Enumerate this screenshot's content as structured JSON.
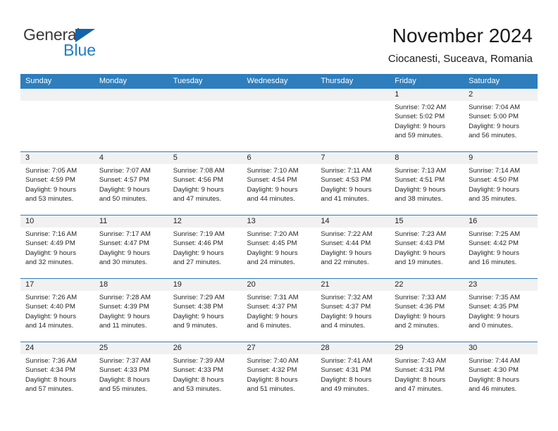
{
  "brand": {
    "name_part1": "General",
    "name_part2": "Blue",
    "triangle_color": "#1264ac",
    "blue_color": "#1f7dc4"
  },
  "header": {
    "title": "November 2024",
    "subtitle": "Ciocanesti, Suceava, Romania"
  },
  "theme": {
    "header_blue": "#2e7ebd",
    "date_band_gray": "#f1f1f1",
    "text_color": "#262626"
  },
  "weekdays": [
    "Sunday",
    "Monday",
    "Tuesday",
    "Wednesday",
    "Thursday",
    "Friday",
    "Saturday"
  ],
  "weeks": [
    [
      {
        "date": "",
        "sunrise": "",
        "sunset": "",
        "daylight_line1": "",
        "daylight_line2": ""
      },
      {
        "date": "",
        "sunrise": "",
        "sunset": "",
        "daylight_line1": "",
        "daylight_line2": ""
      },
      {
        "date": "",
        "sunrise": "",
        "sunset": "",
        "daylight_line1": "",
        "daylight_line2": ""
      },
      {
        "date": "",
        "sunrise": "",
        "sunset": "",
        "daylight_line1": "",
        "daylight_line2": ""
      },
      {
        "date": "",
        "sunrise": "",
        "sunset": "",
        "daylight_line1": "",
        "daylight_line2": ""
      },
      {
        "date": "1",
        "sunrise": "Sunrise: 7:02 AM",
        "sunset": "Sunset: 5:02 PM",
        "daylight_line1": "Daylight: 9 hours",
        "daylight_line2": "and 59 minutes."
      },
      {
        "date": "2",
        "sunrise": "Sunrise: 7:04 AM",
        "sunset": "Sunset: 5:00 PM",
        "daylight_line1": "Daylight: 9 hours",
        "daylight_line2": "and 56 minutes."
      }
    ],
    [
      {
        "date": "3",
        "sunrise": "Sunrise: 7:05 AM",
        "sunset": "Sunset: 4:59 PM",
        "daylight_line1": "Daylight: 9 hours",
        "daylight_line2": "and 53 minutes."
      },
      {
        "date": "4",
        "sunrise": "Sunrise: 7:07 AM",
        "sunset": "Sunset: 4:57 PM",
        "daylight_line1": "Daylight: 9 hours",
        "daylight_line2": "and 50 minutes."
      },
      {
        "date": "5",
        "sunrise": "Sunrise: 7:08 AM",
        "sunset": "Sunset: 4:56 PM",
        "daylight_line1": "Daylight: 9 hours",
        "daylight_line2": "and 47 minutes."
      },
      {
        "date": "6",
        "sunrise": "Sunrise: 7:10 AM",
        "sunset": "Sunset: 4:54 PM",
        "daylight_line1": "Daylight: 9 hours",
        "daylight_line2": "and 44 minutes."
      },
      {
        "date": "7",
        "sunrise": "Sunrise: 7:11 AM",
        "sunset": "Sunset: 4:53 PM",
        "daylight_line1": "Daylight: 9 hours",
        "daylight_line2": "and 41 minutes."
      },
      {
        "date": "8",
        "sunrise": "Sunrise: 7:13 AM",
        "sunset": "Sunset: 4:51 PM",
        "daylight_line1": "Daylight: 9 hours",
        "daylight_line2": "and 38 minutes."
      },
      {
        "date": "9",
        "sunrise": "Sunrise: 7:14 AM",
        "sunset": "Sunset: 4:50 PM",
        "daylight_line1": "Daylight: 9 hours",
        "daylight_line2": "and 35 minutes."
      }
    ],
    [
      {
        "date": "10",
        "sunrise": "Sunrise: 7:16 AM",
        "sunset": "Sunset: 4:49 PM",
        "daylight_line1": "Daylight: 9 hours",
        "daylight_line2": "and 32 minutes."
      },
      {
        "date": "11",
        "sunrise": "Sunrise: 7:17 AM",
        "sunset": "Sunset: 4:47 PM",
        "daylight_line1": "Daylight: 9 hours",
        "daylight_line2": "and 30 minutes."
      },
      {
        "date": "12",
        "sunrise": "Sunrise: 7:19 AM",
        "sunset": "Sunset: 4:46 PM",
        "daylight_line1": "Daylight: 9 hours",
        "daylight_line2": "and 27 minutes."
      },
      {
        "date": "13",
        "sunrise": "Sunrise: 7:20 AM",
        "sunset": "Sunset: 4:45 PM",
        "daylight_line1": "Daylight: 9 hours",
        "daylight_line2": "and 24 minutes."
      },
      {
        "date": "14",
        "sunrise": "Sunrise: 7:22 AM",
        "sunset": "Sunset: 4:44 PM",
        "daylight_line1": "Daylight: 9 hours",
        "daylight_line2": "and 22 minutes."
      },
      {
        "date": "15",
        "sunrise": "Sunrise: 7:23 AM",
        "sunset": "Sunset: 4:43 PM",
        "daylight_line1": "Daylight: 9 hours",
        "daylight_line2": "and 19 minutes."
      },
      {
        "date": "16",
        "sunrise": "Sunrise: 7:25 AM",
        "sunset": "Sunset: 4:42 PM",
        "daylight_line1": "Daylight: 9 hours",
        "daylight_line2": "and 16 minutes."
      }
    ],
    [
      {
        "date": "17",
        "sunrise": "Sunrise: 7:26 AM",
        "sunset": "Sunset: 4:40 PM",
        "daylight_line1": "Daylight: 9 hours",
        "daylight_line2": "and 14 minutes."
      },
      {
        "date": "18",
        "sunrise": "Sunrise: 7:28 AM",
        "sunset": "Sunset: 4:39 PM",
        "daylight_line1": "Daylight: 9 hours",
        "daylight_line2": "and 11 minutes."
      },
      {
        "date": "19",
        "sunrise": "Sunrise: 7:29 AM",
        "sunset": "Sunset: 4:38 PM",
        "daylight_line1": "Daylight: 9 hours",
        "daylight_line2": "and 9 minutes."
      },
      {
        "date": "20",
        "sunrise": "Sunrise: 7:31 AM",
        "sunset": "Sunset: 4:37 PM",
        "daylight_line1": "Daylight: 9 hours",
        "daylight_line2": "and 6 minutes."
      },
      {
        "date": "21",
        "sunrise": "Sunrise: 7:32 AM",
        "sunset": "Sunset: 4:37 PM",
        "daylight_line1": "Daylight: 9 hours",
        "daylight_line2": "and 4 minutes."
      },
      {
        "date": "22",
        "sunrise": "Sunrise: 7:33 AM",
        "sunset": "Sunset: 4:36 PM",
        "daylight_line1": "Daylight: 9 hours",
        "daylight_line2": "and 2 minutes."
      },
      {
        "date": "23",
        "sunrise": "Sunrise: 7:35 AM",
        "sunset": "Sunset: 4:35 PM",
        "daylight_line1": "Daylight: 9 hours",
        "daylight_line2": "and 0 minutes."
      }
    ],
    [
      {
        "date": "24",
        "sunrise": "Sunrise: 7:36 AM",
        "sunset": "Sunset: 4:34 PM",
        "daylight_line1": "Daylight: 8 hours",
        "daylight_line2": "and 57 minutes."
      },
      {
        "date": "25",
        "sunrise": "Sunrise: 7:37 AM",
        "sunset": "Sunset: 4:33 PM",
        "daylight_line1": "Daylight: 8 hours",
        "daylight_line2": "and 55 minutes."
      },
      {
        "date": "26",
        "sunrise": "Sunrise: 7:39 AM",
        "sunset": "Sunset: 4:33 PM",
        "daylight_line1": "Daylight: 8 hours",
        "daylight_line2": "and 53 minutes."
      },
      {
        "date": "27",
        "sunrise": "Sunrise: 7:40 AM",
        "sunset": "Sunset: 4:32 PM",
        "daylight_line1": "Daylight: 8 hours",
        "daylight_line2": "and 51 minutes."
      },
      {
        "date": "28",
        "sunrise": "Sunrise: 7:41 AM",
        "sunset": "Sunset: 4:31 PM",
        "daylight_line1": "Daylight: 8 hours",
        "daylight_line2": "and 49 minutes."
      },
      {
        "date": "29",
        "sunrise": "Sunrise: 7:43 AM",
        "sunset": "Sunset: 4:31 PM",
        "daylight_line1": "Daylight: 8 hours",
        "daylight_line2": "and 47 minutes."
      },
      {
        "date": "30",
        "sunrise": "Sunrise: 7:44 AM",
        "sunset": "Sunset: 4:30 PM",
        "daylight_line1": "Daylight: 8 hours",
        "daylight_line2": "and 46 minutes."
      }
    ]
  ]
}
